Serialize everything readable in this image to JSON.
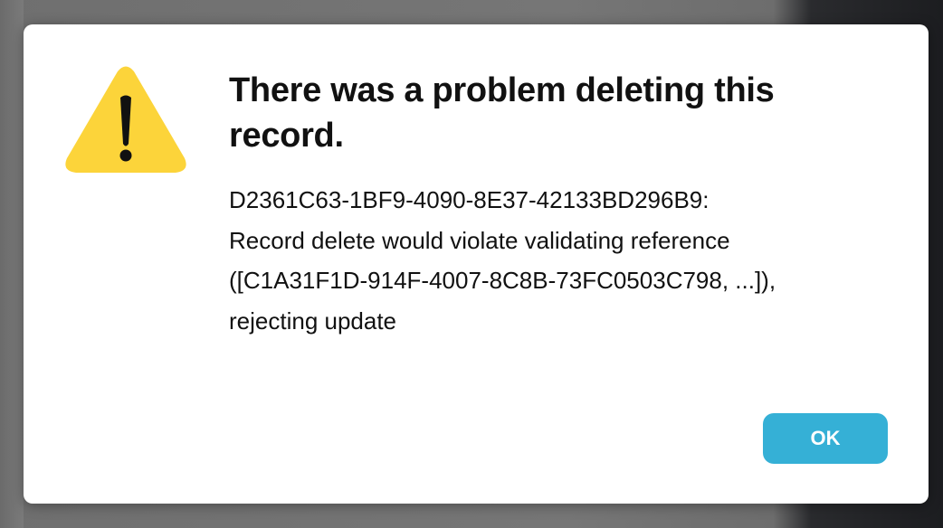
{
  "dialog": {
    "icon": "warning-triangle-icon",
    "title": "There was a problem deleting this record.",
    "message_lines": [
      "D2361C63-1BF9-4090-8E37-42133BD296B9:",
      "Record delete would violate validating reference",
      "([C1A31F1D-914F-4007-8C8B-73FC0503C798, ...]),",
      "rejecting update"
    ],
    "ok_label": "OK"
  },
  "colors": {
    "warning_yellow": "#fcd43a",
    "exclamation": "#111111",
    "ok_button": "#35b0d6",
    "dialog_background": "#ffffff"
  }
}
